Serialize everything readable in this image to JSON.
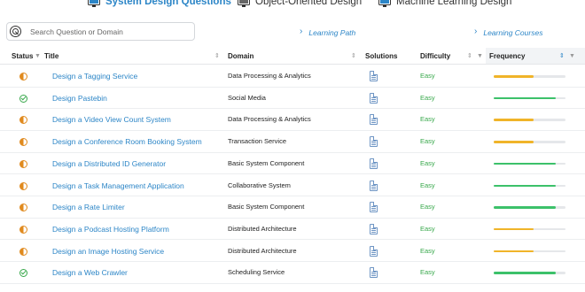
{
  "tabs": [
    {
      "label": "System Design Questions",
      "active": true,
      "icon": "monitor-icon"
    },
    {
      "label": "Object-Oriented Design",
      "active": false,
      "icon": "monitor-icon"
    },
    {
      "label": "Machine Learning Design",
      "active": false,
      "icon": "monitor-icon"
    }
  ],
  "search": {
    "placeholder": "Search Question or Domain",
    "value": ""
  },
  "links": {
    "learning_path": "Learning Path",
    "learning_courses": "Learning Courses"
  },
  "columns": {
    "status": "Status",
    "title": "Title",
    "domain": "Domain",
    "solutions": "Solutions",
    "difficulty": "Difficulty",
    "frequency": "Frequency"
  },
  "colors": {
    "accent": "#2d86c7",
    "easy": "#38a84b",
    "in_progress": "#e08a1e",
    "freq_yellow": "#f0b429",
    "freq_green": "#3cc16a"
  },
  "rows": [
    {
      "status": "in-progress",
      "title": "Design a Tagging Service",
      "domain": "Data Processing & Analytics",
      "difficulty": "Easy",
      "frequency": 0.55,
      "frequency_color": "yellow"
    },
    {
      "status": "done",
      "title": "Design Pastebin",
      "domain": "Social Media",
      "difficulty": "Easy",
      "frequency": 0.86,
      "frequency_color": "green"
    },
    {
      "status": "in-progress",
      "title": "Design a Video View Count System",
      "domain": "Data Processing & Analytics",
      "difficulty": "Easy",
      "frequency": 0.55,
      "frequency_color": "yellow"
    },
    {
      "status": "in-progress",
      "title": "Design a Conference Room Booking System",
      "domain": "Transaction Service",
      "difficulty": "Easy",
      "frequency": 0.55,
      "frequency_color": "yellow"
    },
    {
      "status": "in-progress",
      "title": "Design a Distributed ID Generator",
      "domain": "Basic System Component",
      "difficulty": "Easy",
      "frequency": 0.86,
      "frequency_color": "green"
    },
    {
      "status": "in-progress",
      "title": "Design a Task Management Application",
      "domain": "Collaborative System",
      "difficulty": "Easy",
      "frequency": 0.86,
      "frequency_color": "green"
    },
    {
      "status": "in-progress",
      "title": "Design a Rate Limiter",
      "domain": "Basic System Component",
      "difficulty": "Easy",
      "frequency": 0.86,
      "frequency_color": "green"
    },
    {
      "status": "in-progress",
      "title": "Design a Podcast Hosting Platform",
      "domain": "Distributed Architecture",
      "difficulty": "Easy",
      "frequency": 0.55,
      "frequency_color": "yellow"
    },
    {
      "status": "in-progress",
      "title": "Design an Image Hosting Service",
      "domain": "Distributed Architecture",
      "difficulty": "Easy",
      "frequency": 0.55,
      "frequency_color": "yellow"
    },
    {
      "status": "done",
      "title": "Design a Web Crawler",
      "domain": "Scheduling Service",
      "difficulty": "Easy",
      "frequency": 0.86,
      "frequency_color": "green"
    }
  ]
}
